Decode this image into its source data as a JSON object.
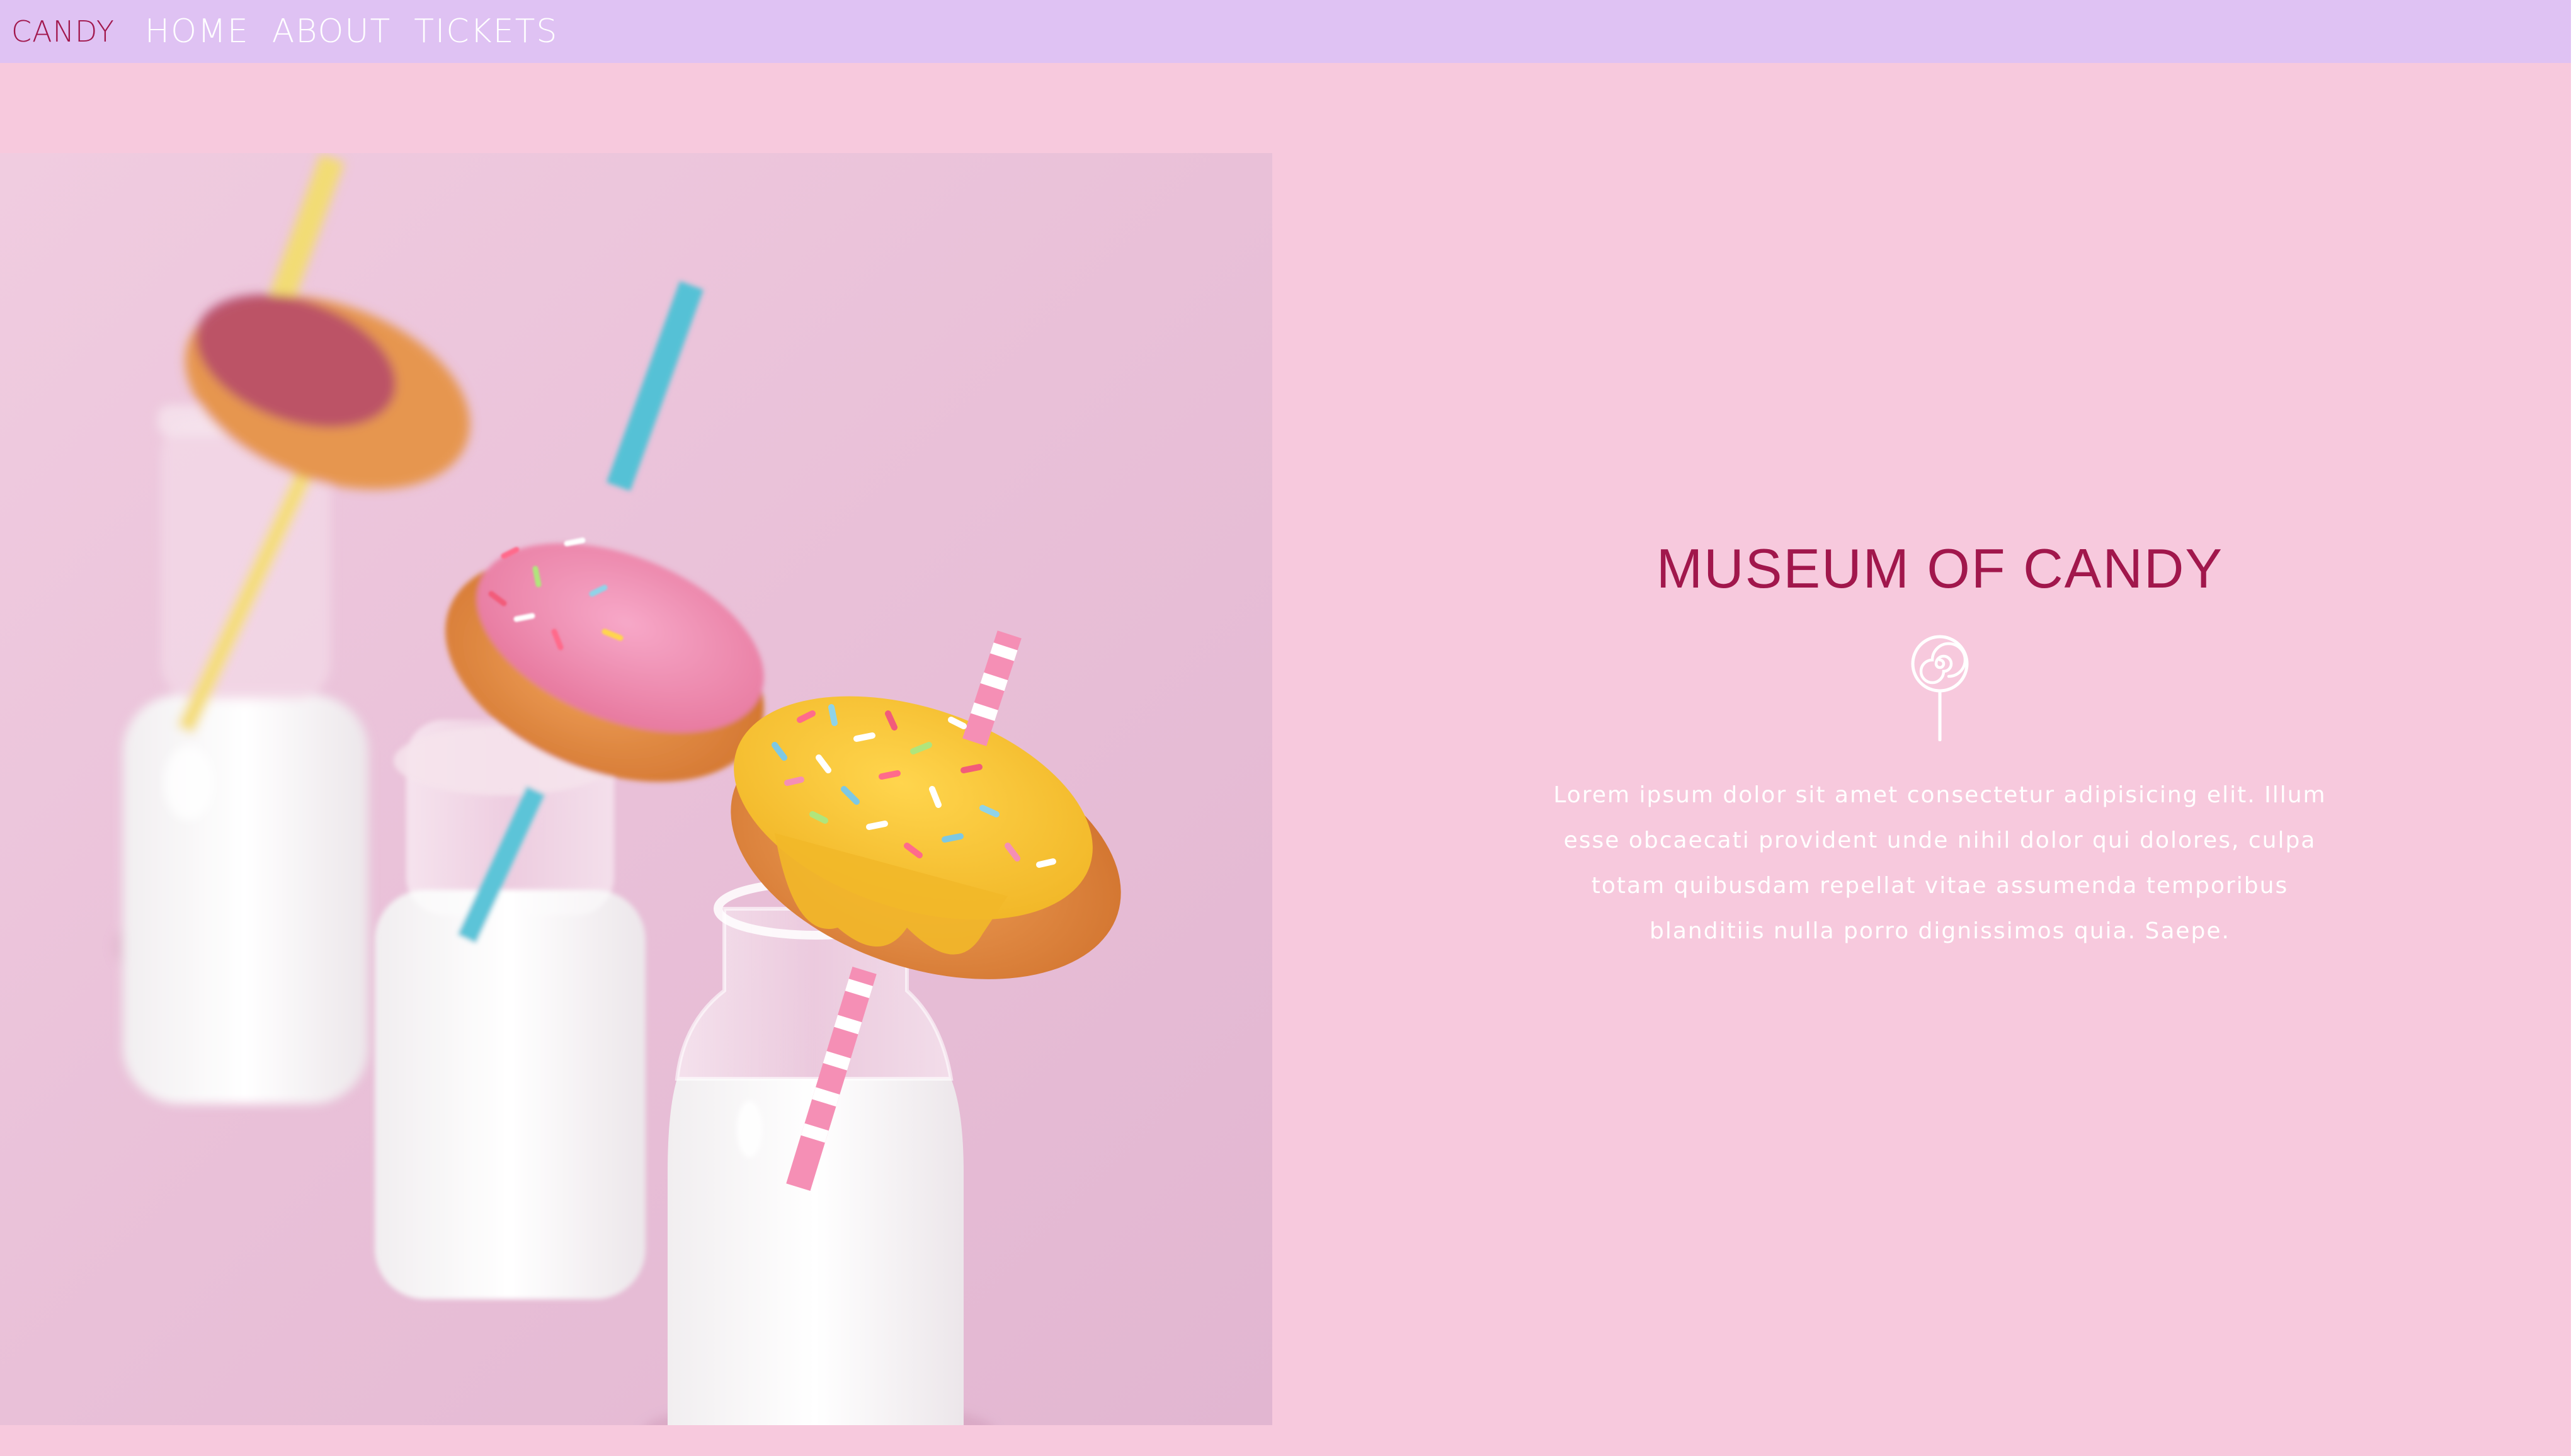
{
  "navbar": {
    "brand": "CANDY",
    "links": [
      {
        "label": "HOME"
      },
      {
        "label": "ABOUT"
      },
      {
        "label": "TICKETS"
      }
    ]
  },
  "hero": {
    "title": "MUSEUM OF CANDY",
    "icon": "lollipop-icon",
    "description": "Lorem ipsum dolor sit amet consectetur adipisicing elit. Illum esse obcaecati provident unde nihil dolor qui dolores, culpa totam quibusdam repellat vitae assumenda temporibus blanditiis nulla porro dignissimos quia. Saepe."
  },
  "colors": {
    "page_background": "#f7c9dd",
    "navbar_background": "#dfc2f3",
    "accent": "#a1174c",
    "text_light": "#ffffff"
  }
}
